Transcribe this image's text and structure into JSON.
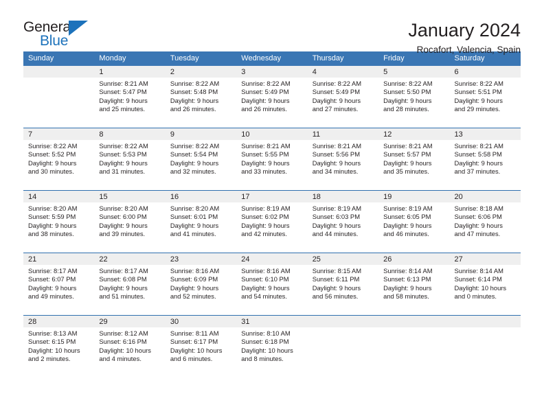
{
  "brand": {
    "name_part1": "General",
    "name_part2": "Blue",
    "flag_icon": "triangle-flag-icon"
  },
  "header": {
    "title": "January 2024",
    "subtitle": "Rocafort, Valencia, Spain"
  },
  "colors": {
    "header_blue": "#3a76b4",
    "separator_blue": "#2f6fae",
    "date_band_gray": "#efefef",
    "brand_blue": "#1c72bb",
    "text": "#231f20"
  },
  "weekday_headers": [
    "Sunday",
    "Monday",
    "Tuesday",
    "Wednesday",
    "Thursday",
    "Friday",
    "Saturday"
  ],
  "calendar_data": {
    "month": "January",
    "year": 2024,
    "location": "Rocafort, Valencia, Spain",
    "first_day_of_week": "Sunday",
    "weeks": [
      [
        {
          "day": ""
        },
        {
          "day": "1",
          "sunrise": "Sunrise: 8:21 AM",
          "sunset": "Sunset: 5:47 PM",
          "daylight1": "Daylight: 9 hours",
          "daylight2": "and 25 minutes."
        },
        {
          "day": "2",
          "sunrise": "Sunrise: 8:22 AM",
          "sunset": "Sunset: 5:48 PM",
          "daylight1": "Daylight: 9 hours",
          "daylight2": "and 26 minutes."
        },
        {
          "day": "3",
          "sunrise": "Sunrise: 8:22 AM",
          "sunset": "Sunset: 5:49 PM",
          "daylight1": "Daylight: 9 hours",
          "daylight2": "and 26 minutes."
        },
        {
          "day": "4",
          "sunrise": "Sunrise: 8:22 AM",
          "sunset": "Sunset: 5:49 PM",
          "daylight1": "Daylight: 9 hours",
          "daylight2": "and 27 minutes."
        },
        {
          "day": "5",
          "sunrise": "Sunrise: 8:22 AM",
          "sunset": "Sunset: 5:50 PM",
          "daylight1": "Daylight: 9 hours",
          "daylight2": "and 28 minutes."
        },
        {
          "day": "6",
          "sunrise": "Sunrise: 8:22 AM",
          "sunset": "Sunset: 5:51 PM",
          "daylight1": "Daylight: 9 hours",
          "daylight2": "and 29 minutes."
        }
      ],
      [
        {
          "day": "7",
          "sunrise": "Sunrise: 8:22 AM",
          "sunset": "Sunset: 5:52 PM",
          "daylight1": "Daylight: 9 hours",
          "daylight2": "and 30 minutes."
        },
        {
          "day": "8",
          "sunrise": "Sunrise: 8:22 AM",
          "sunset": "Sunset: 5:53 PM",
          "daylight1": "Daylight: 9 hours",
          "daylight2": "and 31 minutes."
        },
        {
          "day": "9",
          "sunrise": "Sunrise: 8:22 AM",
          "sunset": "Sunset: 5:54 PM",
          "daylight1": "Daylight: 9 hours",
          "daylight2": "and 32 minutes."
        },
        {
          "day": "10",
          "sunrise": "Sunrise: 8:21 AM",
          "sunset": "Sunset: 5:55 PM",
          "daylight1": "Daylight: 9 hours",
          "daylight2": "and 33 minutes."
        },
        {
          "day": "11",
          "sunrise": "Sunrise: 8:21 AM",
          "sunset": "Sunset: 5:56 PM",
          "daylight1": "Daylight: 9 hours",
          "daylight2": "and 34 minutes."
        },
        {
          "day": "12",
          "sunrise": "Sunrise: 8:21 AM",
          "sunset": "Sunset: 5:57 PM",
          "daylight1": "Daylight: 9 hours",
          "daylight2": "and 35 minutes."
        },
        {
          "day": "13",
          "sunrise": "Sunrise: 8:21 AM",
          "sunset": "Sunset: 5:58 PM",
          "daylight1": "Daylight: 9 hours",
          "daylight2": "and 37 minutes."
        }
      ],
      [
        {
          "day": "14",
          "sunrise": "Sunrise: 8:20 AM",
          "sunset": "Sunset: 5:59 PM",
          "daylight1": "Daylight: 9 hours",
          "daylight2": "and 38 minutes."
        },
        {
          "day": "15",
          "sunrise": "Sunrise: 8:20 AM",
          "sunset": "Sunset: 6:00 PM",
          "daylight1": "Daylight: 9 hours",
          "daylight2": "and 39 minutes."
        },
        {
          "day": "16",
          "sunrise": "Sunrise: 8:20 AM",
          "sunset": "Sunset: 6:01 PM",
          "daylight1": "Daylight: 9 hours",
          "daylight2": "and 41 minutes."
        },
        {
          "day": "17",
          "sunrise": "Sunrise: 8:19 AM",
          "sunset": "Sunset: 6:02 PM",
          "daylight1": "Daylight: 9 hours",
          "daylight2": "and 42 minutes."
        },
        {
          "day": "18",
          "sunrise": "Sunrise: 8:19 AM",
          "sunset": "Sunset: 6:03 PM",
          "daylight1": "Daylight: 9 hours",
          "daylight2": "and 44 minutes."
        },
        {
          "day": "19",
          "sunrise": "Sunrise: 8:19 AM",
          "sunset": "Sunset: 6:05 PM",
          "daylight1": "Daylight: 9 hours",
          "daylight2": "and 46 minutes."
        },
        {
          "day": "20",
          "sunrise": "Sunrise: 8:18 AM",
          "sunset": "Sunset: 6:06 PM",
          "daylight1": "Daylight: 9 hours",
          "daylight2": "and 47 minutes."
        }
      ],
      [
        {
          "day": "21",
          "sunrise": "Sunrise: 8:17 AM",
          "sunset": "Sunset: 6:07 PM",
          "daylight1": "Daylight: 9 hours",
          "daylight2": "and 49 minutes."
        },
        {
          "day": "22",
          "sunrise": "Sunrise: 8:17 AM",
          "sunset": "Sunset: 6:08 PM",
          "daylight1": "Daylight: 9 hours",
          "daylight2": "and 51 minutes."
        },
        {
          "day": "23",
          "sunrise": "Sunrise: 8:16 AM",
          "sunset": "Sunset: 6:09 PM",
          "daylight1": "Daylight: 9 hours",
          "daylight2": "and 52 minutes."
        },
        {
          "day": "24",
          "sunrise": "Sunrise: 8:16 AM",
          "sunset": "Sunset: 6:10 PM",
          "daylight1": "Daylight: 9 hours",
          "daylight2": "and 54 minutes."
        },
        {
          "day": "25",
          "sunrise": "Sunrise: 8:15 AM",
          "sunset": "Sunset: 6:11 PM",
          "daylight1": "Daylight: 9 hours",
          "daylight2": "and 56 minutes."
        },
        {
          "day": "26",
          "sunrise": "Sunrise: 8:14 AM",
          "sunset": "Sunset: 6:13 PM",
          "daylight1": "Daylight: 9 hours",
          "daylight2": "and 58 minutes."
        },
        {
          "day": "27",
          "sunrise": "Sunrise: 8:14 AM",
          "sunset": "Sunset: 6:14 PM",
          "daylight1": "Daylight: 10 hours",
          "daylight2": "and 0 minutes."
        }
      ],
      [
        {
          "day": "28",
          "sunrise": "Sunrise: 8:13 AM",
          "sunset": "Sunset: 6:15 PM",
          "daylight1": "Daylight: 10 hours",
          "daylight2": "and 2 minutes."
        },
        {
          "day": "29",
          "sunrise": "Sunrise: 8:12 AM",
          "sunset": "Sunset: 6:16 PM",
          "daylight1": "Daylight: 10 hours",
          "daylight2": "and 4 minutes."
        },
        {
          "day": "30",
          "sunrise": "Sunrise: 8:11 AM",
          "sunset": "Sunset: 6:17 PM",
          "daylight1": "Daylight: 10 hours",
          "daylight2": "and 6 minutes."
        },
        {
          "day": "31",
          "sunrise": "Sunrise: 8:10 AM",
          "sunset": "Sunset: 6:18 PM",
          "daylight1": "Daylight: 10 hours",
          "daylight2": "and 8 minutes."
        },
        {
          "day": ""
        },
        {
          "day": ""
        },
        {
          "day": ""
        }
      ]
    ]
  }
}
